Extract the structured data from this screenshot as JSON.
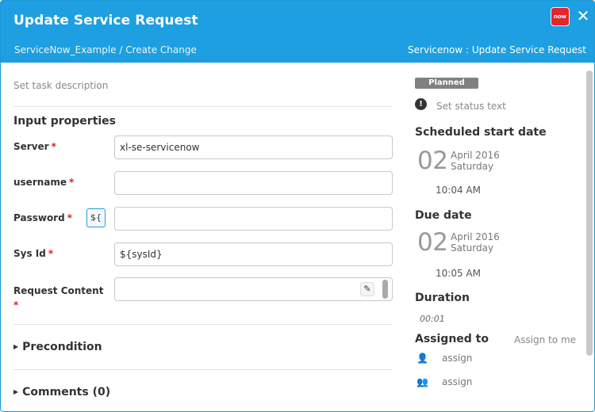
{
  "header": {
    "title": "Update Service Request",
    "breadcrumb": "ServiceNow_Example / Create Change",
    "plugin_label": "Servicenow : Update Service Request",
    "logo_text": "now",
    "close_glyph": "✕"
  },
  "task": {
    "description_placeholder": "Set task description"
  },
  "input_properties": {
    "title": "Input properties",
    "server": {
      "label": "Server",
      "value": "xl-se-servicenow",
      "required": "*"
    },
    "username": {
      "label": "username",
      "value": "",
      "required": "*"
    },
    "password": {
      "label": "Password",
      "value": "",
      "required": "*",
      "variable_button": "${"
    },
    "sys_id": {
      "label": "Sys Id",
      "value": "${sysId}",
      "required": "*"
    },
    "request_content": {
      "label": "Request Content",
      "value": "",
      "required": "*"
    }
  },
  "sections": {
    "precondition": "Precondition",
    "comments": "Comments (0)"
  },
  "status": {
    "badge": "Planned",
    "status_text_placeholder": "Set status text"
  },
  "scheduled_start": {
    "label": "Scheduled start date",
    "day": "02",
    "month_year": "April 2016",
    "weekday": "Saturday",
    "time": "10:04 AM"
  },
  "due_date": {
    "label": "Due date",
    "day": "02",
    "month_year": "April 2016",
    "weekday": "Saturday",
    "time": "10:05 AM"
  },
  "duration": {
    "label": "Duration",
    "value": "00:01"
  },
  "assigned": {
    "label": "Assigned to",
    "assign_to_me": "Assign to me",
    "user_placeholder": "assign",
    "team_placeholder": "assign"
  },
  "colors": {
    "header": "#1d9fe1",
    "required": "#e02020",
    "badge": "#808080",
    "logo": "#e4262a"
  }
}
